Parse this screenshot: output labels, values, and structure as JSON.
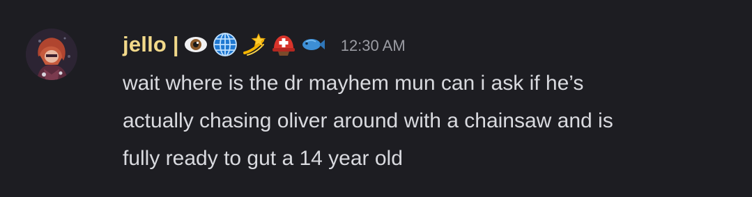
{
  "message": {
    "author": "jello |",
    "badges": [
      "eye-icon",
      "globe-icon",
      "dizzy-icon",
      "rescue-helmet-icon",
      "fish-icon"
    ],
    "timestamp": "12:30 AM",
    "lines": [
      "wait where is the dr mayhem mun can i ask if he’s",
      "actually chasing oliver around with a chainsaw and is",
      "fully ready to gut a 14 year old"
    ]
  },
  "colors": {
    "background": "#1d1d22",
    "username": "#f2d98a",
    "text": "#d9dadf",
    "timestamp": "#9b9ca3"
  }
}
